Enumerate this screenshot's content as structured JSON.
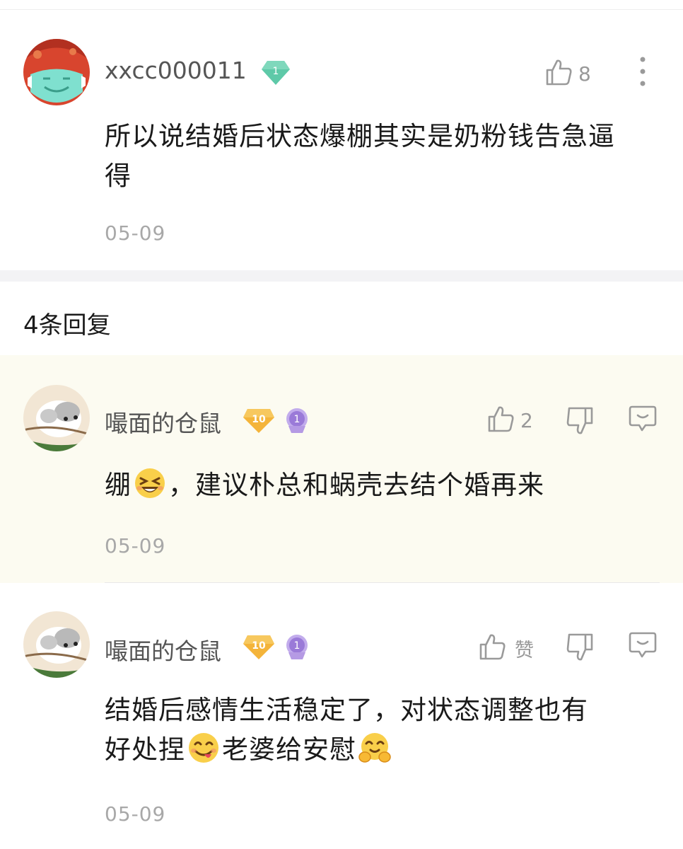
{
  "main_comment": {
    "username": "xxcc000011",
    "level_badge": "1",
    "like_count": "8",
    "text": "所以说结婚后状态爆棚其实是奶粉钱告急逼得",
    "date": "05-09"
  },
  "replies_header": "4条回复",
  "replies": [
    {
      "username": "嘬面的仓鼠",
      "level_badge": "10",
      "rank_badge": "1",
      "like_count": "2",
      "text_before": "绷",
      "text_after": "，建议朴总和蜗壳去结个婚再来",
      "date": "05-09"
    },
    {
      "username": "嘬面的仓鼠",
      "level_badge": "10",
      "rank_badge": "1",
      "like_label": "赞",
      "text_line1": "结婚后感情生活稳定了，对状态调整也有",
      "text_line2_a": "好处捏",
      "text_line2_b": "老婆给安慰",
      "date": "05-09"
    }
  ],
  "icons": [
    "thumbs-up-icon",
    "thumbs-down-icon",
    "reply-bubble-icon",
    "more-vertical-icon"
  ],
  "colors": {
    "highlight": "#fcfbf1",
    "date": "#a8a8a8",
    "icon": "#9a9a9a",
    "gem": "#5ec9a8",
    "gold": "#f4b43a",
    "purple": "#a98ad9"
  }
}
